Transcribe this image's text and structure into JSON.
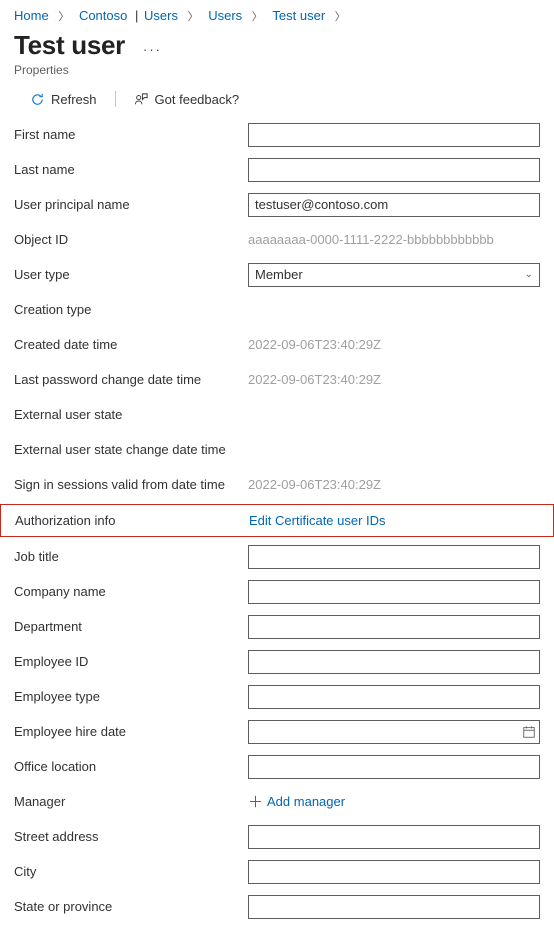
{
  "breadcrumb": {
    "home": "Home",
    "org": "Contoso",
    "users1": "Users",
    "users2": "Users",
    "user": "Test user"
  },
  "page": {
    "title": "Test user",
    "subtitle": "Properties"
  },
  "toolbar": {
    "refresh": "Refresh",
    "feedback": "Got feedback?"
  },
  "fields": {
    "first_name": {
      "label": "First name",
      "value": ""
    },
    "last_name": {
      "label": "Last name",
      "value": ""
    },
    "upn": {
      "label": "User principal name",
      "value": "testuser@contoso.com"
    },
    "object_id": {
      "label": "Object ID",
      "value": "aaaaaaaa-0000-1111-2222-bbbbbbbbbbbb"
    },
    "user_type": {
      "label": "User type",
      "value": "Member"
    },
    "creation_type": {
      "label": "Creation type"
    },
    "created": {
      "label": "Created date time",
      "value": "2022-09-06T23:40:29Z"
    },
    "last_pwd": {
      "label": "Last password change date time",
      "value": "2022-09-06T23:40:29Z"
    },
    "ext_state": {
      "label": "External user state"
    },
    "ext_state_change": {
      "label": "External user state change date time"
    },
    "signin_valid": {
      "label": "Sign in sessions valid from date time",
      "value": "2022-09-06T23:40:29Z"
    },
    "auth_info": {
      "label": "Authorization info",
      "link": "Edit Certificate user IDs"
    },
    "job_title": {
      "label": "Job title",
      "value": ""
    },
    "company": {
      "label": "Company name",
      "value": ""
    },
    "department": {
      "label": "Department",
      "value": ""
    },
    "emp_id": {
      "label": "Employee ID",
      "value": ""
    },
    "emp_type": {
      "label": "Employee type",
      "value": ""
    },
    "emp_hire": {
      "label": "Employee hire date",
      "value": ""
    },
    "office": {
      "label": "Office location",
      "value": ""
    },
    "manager": {
      "label": "Manager",
      "link": "Add manager"
    },
    "street": {
      "label": "Street address",
      "value": ""
    },
    "city": {
      "label": "City",
      "value": ""
    },
    "state": {
      "label": "State or province",
      "value": ""
    }
  }
}
